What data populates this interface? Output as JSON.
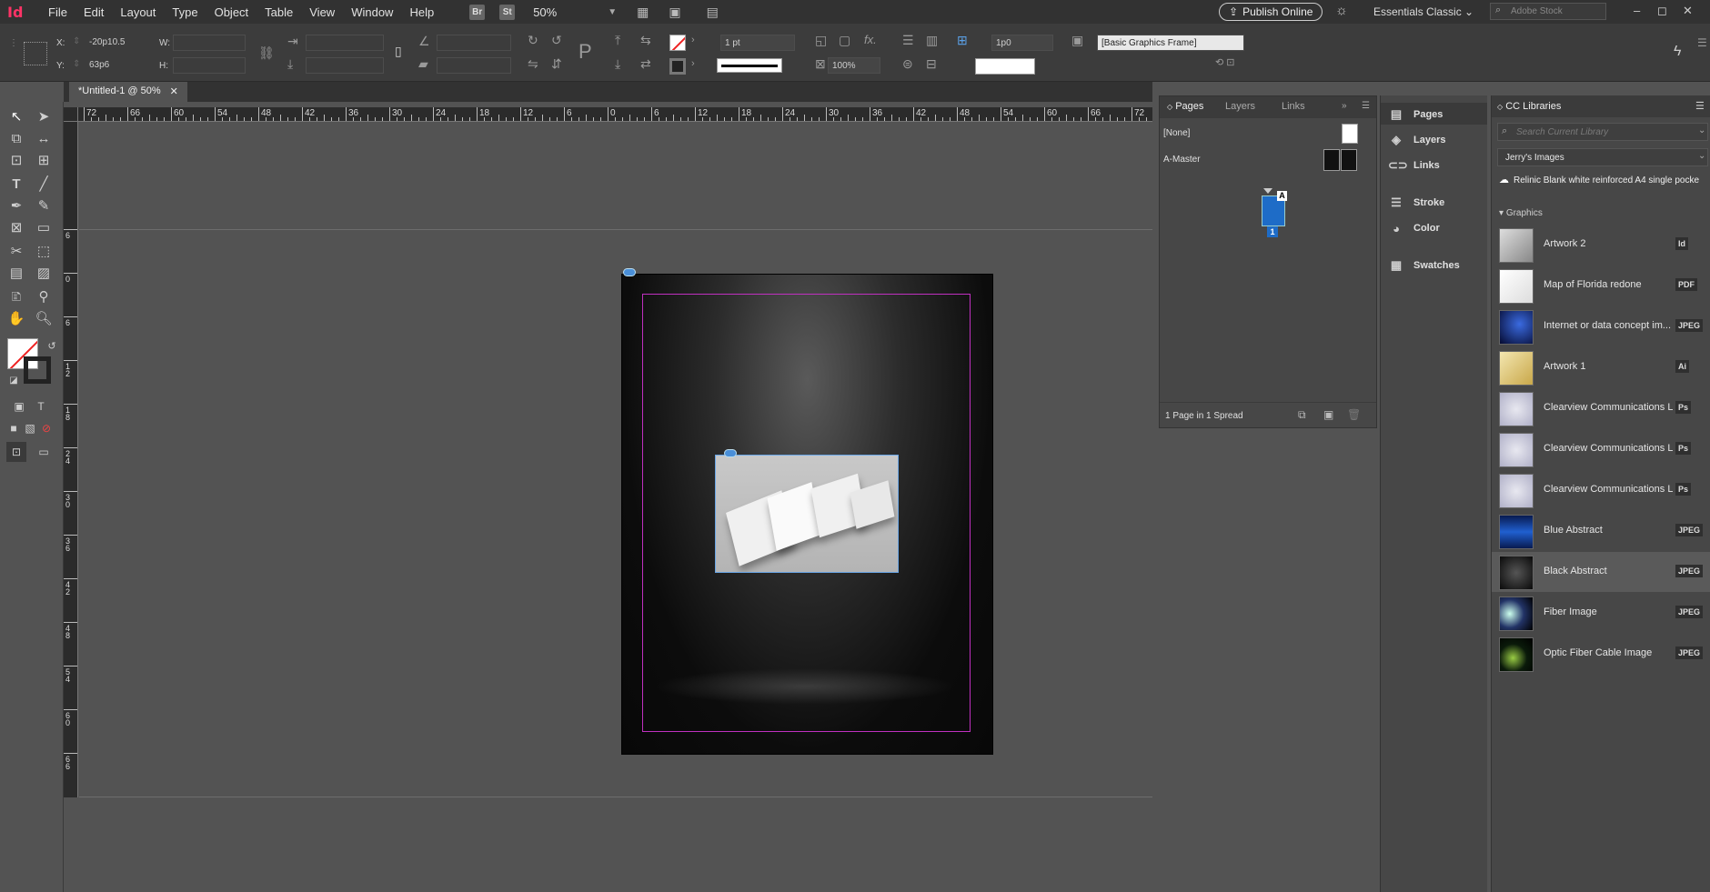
{
  "menubar": {
    "logo": "Id",
    "items": [
      "File",
      "Edit",
      "Layout",
      "Type",
      "Object",
      "Table",
      "View",
      "Window",
      "Help"
    ],
    "bridge": "Br",
    "stock_btn": "St",
    "zoom": "50%",
    "publish": "Publish Online",
    "workspace": "Essentials Classic",
    "search_placeholder": "Adobe Stock"
  },
  "control": {
    "x_label": "X:",
    "x_value": "-20p10.5",
    "y_label": "Y:",
    "y_value": "63p6",
    "w_label": "W:",
    "h_label": "H:",
    "stroke_weight": "1 pt",
    "opacity": "100%",
    "gap": "1p0",
    "object_style": "[Basic Graphics Frame]"
  },
  "document": {
    "tab_title": "*Untitled-1 @ 50%",
    "tab_close": "✕"
  },
  "ruler": {
    "h_labels": [
      "72",
      "66",
      "60",
      "54",
      "48",
      "42",
      "36",
      "30",
      "24",
      "18",
      "12",
      "6",
      "0",
      "6",
      "12",
      "18",
      "24",
      "30",
      "36",
      "42",
      "48",
      "54",
      "60",
      "66",
      "72"
    ],
    "v_labels": [
      "6",
      "0",
      "6",
      "1 2",
      "1 8",
      "2 4",
      "3 0",
      "3 6",
      "4 2",
      "4 8",
      "5 4",
      "6 0",
      "6 6"
    ]
  },
  "pages_panel": {
    "tabs": [
      "Pages",
      "Layers",
      "Links"
    ],
    "none_label": "[None]",
    "master_label": "A-Master",
    "page_number": "1",
    "master_prefix": "A",
    "footer": "1 Page in 1 Spread"
  },
  "dock": {
    "group1": [
      "Pages",
      "Layers",
      "Links"
    ],
    "group2": [
      "Stroke",
      "Color"
    ],
    "group3": [
      "Swatches"
    ]
  },
  "libraries": {
    "title": "CC Libraries",
    "search_placeholder": "Search Current Library",
    "library_name": "Jerry's Images",
    "sync_item": "Relinic Blank white reinforced A4 single pocke",
    "section": "Graphics",
    "items": [
      {
        "name": "Artwork 2",
        "badge": "Id"
      },
      {
        "name": "Map of Florida redone",
        "badge": "PDF"
      },
      {
        "name": "Internet or data concept im...",
        "badge": "JPEG"
      },
      {
        "name": "Artwork 1",
        "badge": "Ai"
      },
      {
        "name": "Clearview Communications L...",
        "badge": "Ps"
      },
      {
        "name": "Clearview Communications L...",
        "badge": "Ps"
      },
      {
        "name": "Clearview Communications L...",
        "badge": "Ps"
      },
      {
        "name": "Blue Abstract",
        "badge": "JPEG"
      },
      {
        "name": "Black Abstract",
        "badge": "JPEG"
      },
      {
        "name": "Fiber Image",
        "badge": "JPEG"
      },
      {
        "name": "Optic Fiber Cable Image",
        "badge": "JPEG"
      }
    ]
  },
  "colors": {
    "accent": "#4a8fd8",
    "margin_guide": "#c030c0",
    "selected_row": "#5a5a5a"
  }
}
